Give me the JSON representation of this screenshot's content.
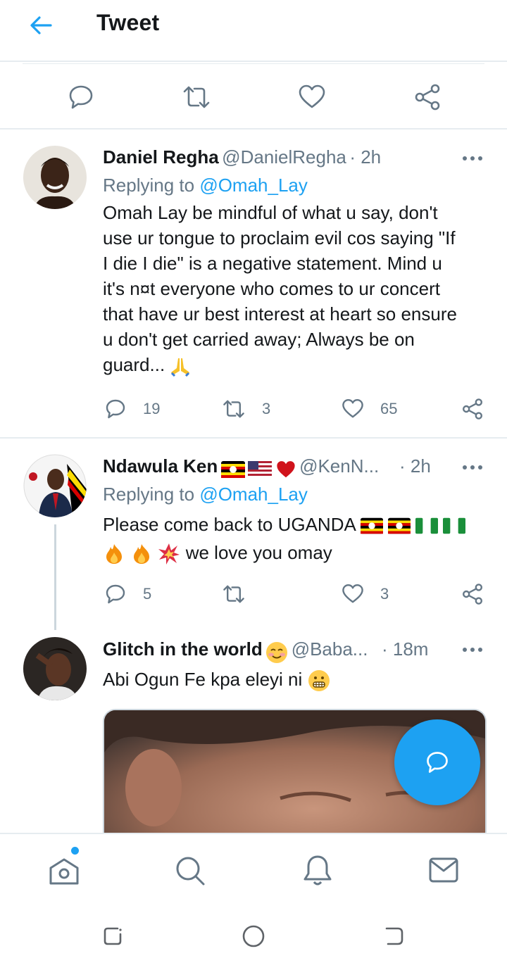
{
  "header": {
    "title": "Tweet"
  },
  "tweets": [
    {
      "name": "Daniel Regha",
      "handle": "@DanielRegha",
      "time": "· 2h",
      "reply_prefix": "Replying to ",
      "reply_to": "@Omah_Lay",
      "lines": [
        "Omah Lay be mindful of what u say, don't",
        "use ur tongue to proclaim evil cos saying \"If",
        "I die I die\" is a negative statement. Mind u",
        "it's n¤t everyone who comes to ur concert",
        "that have ur best interest at heart so ensure",
        "u don't get carried away; Always be on",
        "guard..."
      ],
      "replies": "19",
      "retweets": "3",
      "likes": "65"
    },
    {
      "name": "Ndawula Ken",
      "handle": "@KenN...",
      "time": "· 2h",
      "reply_prefix": "Replying to ",
      "reply_to": "@Omah_Lay",
      "line1": "Please come back to UGANDA",
      "line2": "we love you omay",
      "replies": "5",
      "retweets": "",
      "likes": "3"
    },
    {
      "name": "Glitch in the world",
      "handle": "@Baba...",
      "time": "· 18m",
      "line1": "Abi Ogun Fe kpa eleyi ni"
    }
  ],
  "colors": {
    "accent": "#1da1f2",
    "muted": "#657786",
    "text": "#14171a",
    "divider": "#e6ecf0"
  },
  "icons": {
    "back": "arrow-left-icon",
    "reply": "speech-bubble-icon",
    "retweet": "retweet-icon",
    "like": "heart-icon",
    "share": "share-icon",
    "more": "more-dots-icon",
    "nav": [
      "home-icon",
      "search-icon",
      "bell-icon",
      "mail-icon"
    ],
    "system": [
      "recents-icon",
      "home-circle-icon",
      "back-icon"
    ]
  }
}
